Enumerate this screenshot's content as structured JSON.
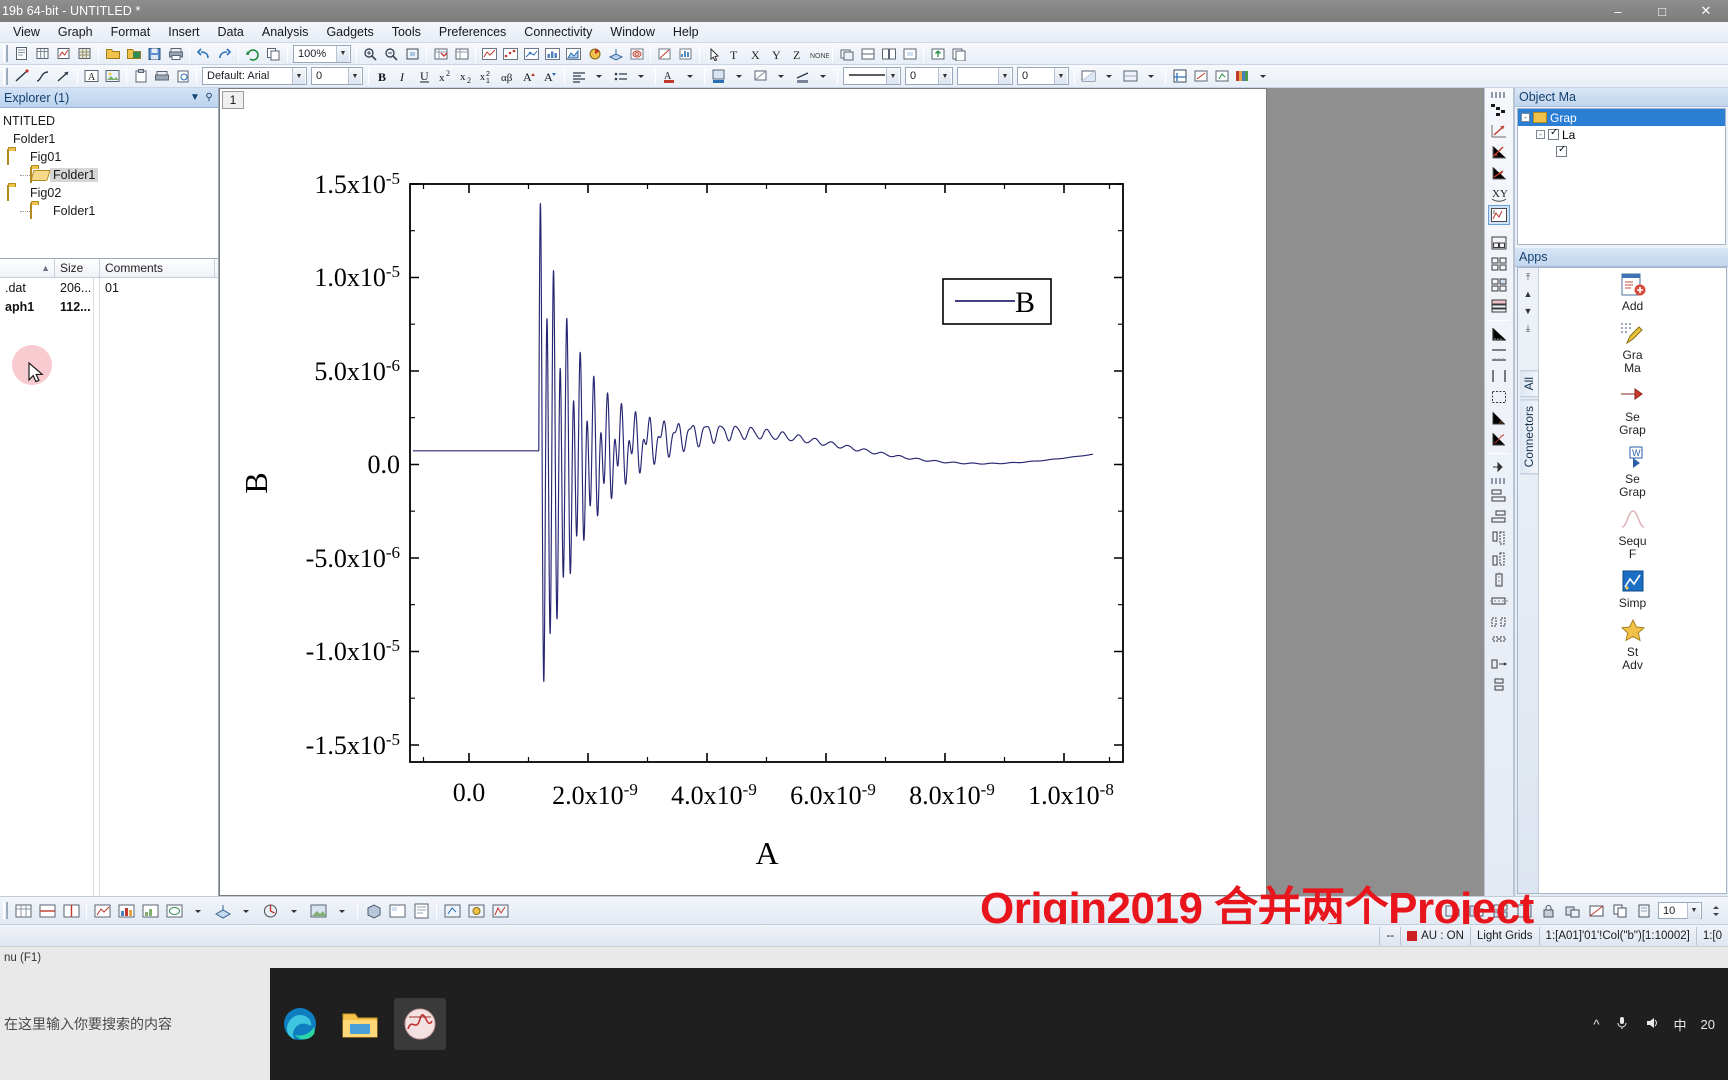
{
  "window": {
    "title": "19b 64-bit - UNTITLED *",
    "minimize": "–",
    "maximize": "□",
    "close": "✕"
  },
  "menubar": {
    "items": [
      {
        "label": "View"
      },
      {
        "label": "Graph"
      },
      {
        "label": "Format"
      },
      {
        "label": "Insert"
      },
      {
        "label": "Data"
      },
      {
        "label": "Analysis"
      },
      {
        "label": "Gadgets"
      },
      {
        "label": "Tools"
      },
      {
        "label": "Preferences"
      },
      {
        "label": "Connectivity"
      },
      {
        "label": "Window"
      },
      {
        "label": "Help"
      }
    ]
  },
  "toolbar_top": {
    "zoom_value": "100%"
  },
  "toolbar_format": {
    "font_value": "Default: Arial",
    "size_value": "0",
    "line_width_value": "0",
    "value_a": "0",
    "value_b": "0"
  },
  "explorer": {
    "title": "Explorer (1)",
    "collapse_icon": "▼",
    "pin_icon": "⚲",
    "tree": [
      {
        "label": "NTITLED",
        "indent": 0,
        "type": "root",
        "selected": false
      },
      {
        "label": "Folder1",
        "indent": 1,
        "type": "plain",
        "selected": false
      },
      {
        "label": "Fig01",
        "indent": 1,
        "type": "folder",
        "selected": false
      },
      {
        "label": "Folder1",
        "indent": 2,
        "type": "folder-open",
        "selected": true
      },
      {
        "label": "Fig02",
        "indent": 1,
        "type": "folder",
        "selected": false
      },
      {
        "label": "Folder1",
        "indent": 2,
        "type": "folder",
        "selected": false
      }
    ],
    "columns": [
      "",
      "Size",
      "Comments"
    ],
    "sort_icon": "▲",
    "rows": [
      {
        "name": ".dat",
        "size": "206...",
        "comments": "01",
        "bold": false
      },
      {
        "name": "aph1",
        "size": "112...",
        "comments": "",
        "bold": true
      }
    ]
  },
  "graph": {
    "tab_label": "1",
    "legend_label": "B"
  },
  "chart_data": {
    "type": "line",
    "title": "",
    "xlabel": "A",
    "ylabel": "B",
    "xlim": [
      -1.1e-09,
      1.08e-08
    ],
    "ylim": [
      -1.75e-05,
      1.5e-05
    ],
    "xticks": [
      0.0,
      2e-09,
      4e-09,
      6e-09,
      8e-09,
      1e-08
    ],
    "xtick_labels": [
      "0.0",
      "2.0x10-9",
      "4.0x10-9",
      "6.0x10-9",
      "8.0x10-9",
      "1.0x10-8"
    ],
    "yticks": [
      -1.5e-05,
      -1e-05,
      -5e-06,
      0.0,
      5e-06,
      1e-05,
      1.5e-05
    ],
    "ytick_labels": [
      "-1.5x10-5",
      "-1.0x10-5",
      "-5.0x10-6",
      "0.0",
      "5.0x10-6",
      "1.0x10-5",
      "1.5x10-5"
    ],
    "minor_ticks": true,
    "grid": false,
    "legend": {
      "position": "top-right",
      "entries": [
        "B"
      ]
    },
    "series": [
      {
        "name": "B",
        "color": "#262673",
        "description": "Damped oscillatory transient: flat zero baseline until ~1.05e-9 s, then a high-frequency ringing burst peaking at +1.2e-5 and -1.35e-5, decaying through a chirped oscillation that slows and damps to a slow low-amplitude swing peaking ~+1.3e-6 near 6.2e-9 s and settling near -0.9e-6 at 1.0e-8 s."
      }
    ]
  },
  "object_manager": {
    "title": "Object Ma",
    "rows": [
      {
        "label": "Grap",
        "indent": 0,
        "selected": true,
        "checkbox": false,
        "expander": "-",
        "folder": true
      },
      {
        "label": "La",
        "indent": 1,
        "selected": false,
        "checkbox": true,
        "expander": "-",
        "folder": false
      },
      {
        "label": "",
        "indent": 2,
        "selected": false,
        "checkbox": true,
        "expander": "",
        "folder": false
      }
    ]
  },
  "apps": {
    "title": "Apps",
    "scroll_buttons": [
      "⤒",
      "▲",
      "▼",
      "⤓"
    ],
    "tabs": [
      "All",
      "Connectors"
    ],
    "items": [
      {
        "label": "Add",
        "icon": "add-app-icon"
      },
      {
        "label": "Gra\nMa",
        "icon": "graph-maker-icon"
      },
      {
        "label": "Se\nGrap",
        "icon": "send-graph-icon"
      },
      {
        "label": "Se\nGrap",
        "icon": "send-graph2-icon"
      },
      {
        "label": "Sequ\nF",
        "icon": "sequence-icon"
      },
      {
        "label": "Simp",
        "icon": "simple-fit-icon"
      },
      {
        "label": "St\nAdv",
        "icon": "stats-advanced-icon"
      }
    ]
  },
  "overlay": {
    "red_text": "Origin2019 合并两个Project"
  },
  "statusbar": {
    "hint": "nu (F1)",
    "dashes": "--",
    "au": "AU : ON",
    "grids": "Light Grids",
    "range1": "1:[A01]'01'!Col(\"b\")[1:10002]",
    "range2": "1:[0"
  },
  "taskbar": {
    "search_placeholder": "在这里输入你要搜索的内容",
    "apps": [
      "edge-icon",
      "file-explorer-icon",
      "origin-icon"
    ],
    "tray": [
      "^",
      "mic-icon",
      "speaker-icon",
      "中"
    ],
    "clock": "20"
  },
  "colors": {
    "plot_line": "#262673",
    "accent_blue": "#2a7fd4",
    "red_overlay": "#e8161c",
    "folder_yellow": "#f0c14b"
  }
}
